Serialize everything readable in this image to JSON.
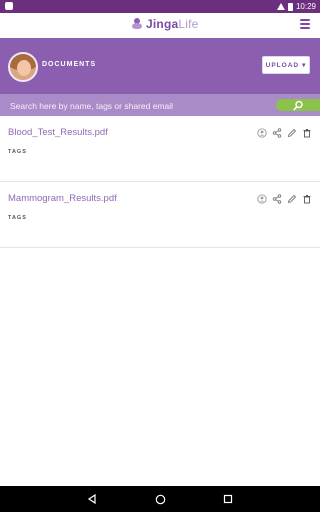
{
  "statusbar": {
    "time": "10:29"
  },
  "header": {
    "brand_main": "Jinga",
    "brand_sub": "Life"
  },
  "toolbar": {
    "title": "DOCUMENTS",
    "upload_label": "UPLOAD",
    "upload_caret": "▾"
  },
  "search": {
    "placeholder": "Search here by name, tags or shared email"
  },
  "documents": [
    {
      "name": "Blood_Test_Results.pdf",
      "tags_label": "TAGS"
    },
    {
      "name": "Mammogram_Results.pdf",
      "tags_label": "TAGS"
    }
  ],
  "colors": {
    "purple": "#8c5eb0",
    "search_bar": "#a98cc7",
    "green": "#8bc34a",
    "link": "#8f6ab2"
  },
  "icons": {
    "row_actions": [
      "user-circle-icon",
      "share-icon",
      "edit-icon",
      "trash-icon"
    ],
    "nav": [
      "back-icon",
      "home-icon",
      "recents-icon"
    ]
  }
}
